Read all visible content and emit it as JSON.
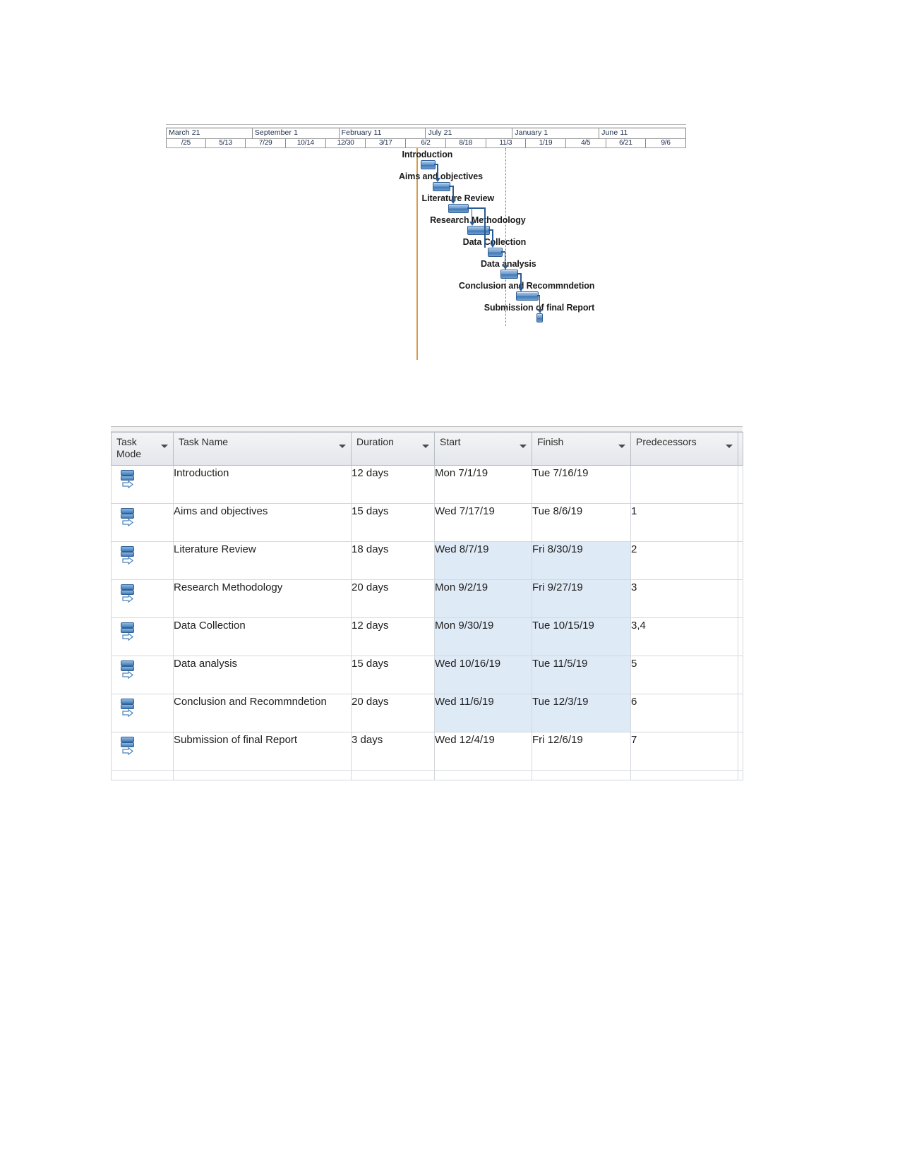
{
  "chart_data": {
    "type": "bar",
    "subtype": "gantt",
    "title": "",
    "xlabel": "",
    "ylabel": "",
    "grid": false,
    "legend": "none",
    "timeline": {
      "major_ticks": [
        "March 21",
        "September 1",
        "February 11",
        "July 21",
        "January 1",
        "June 11"
      ],
      "minor_ticks": [
        "/25",
        "5/13",
        "7/29",
        "10/14",
        "12/30",
        "3/17",
        "6/2",
        "8/18",
        "11/3",
        "1/19",
        "4/5",
        "6/21",
        "9/6"
      ]
    },
    "markers": [
      {
        "name": "progress-line",
        "color": "#d79b45",
        "style": "solid",
        "near_tick": "6/2"
      },
      {
        "name": "status-line",
        "color": "#6b6b6b",
        "style": "dotted",
        "near_tick": "11/3"
      }
    ],
    "categories": [
      "Introduction",
      "Aims and objectives",
      "Literature Review",
      "Research Methodology",
      "Data Collection",
      "Data analysis",
      "Conclusion and Recommndetion",
      "Submission of final Report"
    ],
    "values": [
      12,
      15,
      18,
      20,
      12,
      15,
      20,
      3
    ],
    "value_unit": "days",
    "bars": [
      {
        "label": "Introduction",
        "start": "Mon 7/1/19",
        "finish": "Tue 7/16/19",
        "days": 12,
        "left_pct": 49.0,
        "width_pct": 2.5
      },
      {
        "label": "Aims and objectives",
        "start": "Wed 7/17/19",
        "finish": "Tue 8/6/19",
        "days": 15,
        "left_pct": 51.3,
        "width_pct": 3.1
      },
      {
        "label": "Literature Review",
        "start": "Wed 8/7/19",
        "finish": "Fri 8/30/19",
        "days": 18,
        "left_pct": 54.3,
        "width_pct": 3.7
      },
      {
        "label": "Research Methodology",
        "start": "Mon 9/2/19",
        "finish": "Fri 9/27/19",
        "days": 20,
        "left_pct": 57.9,
        "width_pct": 4.1
      },
      {
        "label": "Data Collection",
        "start": "Mon 9/30/19",
        "finish": "Tue 10/15/19",
        "days": 12,
        "left_pct": 61.9,
        "width_pct": 2.5
      },
      {
        "label": "Data analysis",
        "start": "Wed 10/16/19",
        "finish": "Tue 11/5/19",
        "days": 15,
        "left_pct": 64.3,
        "width_pct": 3.1
      },
      {
        "label": "Conclusion and Recommndetion",
        "start": "Wed 11/6/19",
        "finish": "Tue 12/3/19",
        "days": 20,
        "left_pct": 67.3,
        "width_pct": 4.1
      },
      {
        "label": "Submission of final Report",
        "start": "Wed 12/4/19",
        "finish": "Fri 12/6/19",
        "days": 3,
        "left_pct": 71.3,
        "width_pct": 0.9
      }
    ]
  },
  "table": {
    "columns": [
      {
        "key": "mode",
        "label": "Task Mode",
        "sortable": true,
        "highlighted": false
      },
      {
        "key": "name",
        "label": "Task Name",
        "sortable": true,
        "highlighted": false
      },
      {
        "key": "duration",
        "label": "Duration",
        "sortable": true,
        "highlighted": false
      },
      {
        "key": "start",
        "label": "Start",
        "sortable": true,
        "highlighted": true
      },
      {
        "key": "finish",
        "label": "Finish",
        "sortable": true,
        "highlighted": false
      },
      {
        "key": "pred",
        "label": "Predecessors",
        "sortable": true,
        "highlighted": false
      }
    ],
    "rows": [
      {
        "name": "Introduction",
        "duration": "12 days",
        "start": "Mon 7/1/19",
        "finish": "Tue 7/16/19",
        "pred": "",
        "highlight": false
      },
      {
        "name": "Aims and objectives",
        "duration": "15 days",
        "start": "Wed 7/17/19",
        "finish": "Tue 8/6/19",
        "pred": "1",
        "highlight": false
      },
      {
        "name": "Literature Review",
        "duration": "18 days",
        "start": "Wed 8/7/19",
        "finish": "Fri 8/30/19",
        "pred": "2",
        "highlight": true
      },
      {
        "name": "Research Methodology",
        "duration": "20 days",
        "start": "Mon 9/2/19",
        "finish": "Fri 9/27/19",
        "pred": "3",
        "highlight": true
      },
      {
        "name": "Data Collection",
        "duration": "12 days",
        "start": "Mon 9/30/19",
        "finish": "Tue 10/15/19",
        "pred": "3,4",
        "highlight": true
      },
      {
        "name": "Data analysis",
        "duration": "15 days",
        "start": "Wed 10/16/19",
        "finish": "Tue 11/5/19",
        "pred": "5",
        "highlight": true
      },
      {
        "name": "Conclusion and Recommndetion",
        "duration": "20 days",
        "start": "Wed 11/6/19",
        "finish": "Tue 12/3/19",
        "pred": "6",
        "highlight": true
      },
      {
        "name": "Submission of final Report",
        "duration": "3 days",
        "start": "Wed 12/4/19",
        "finish": "Fri 12/6/19",
        "pred": "7",
        "highlight": false
      }
    ]
  },
  "colors": {
    "bar_fill": "#3f78b4",
    "bar_border": "#2f5f94",
    "link_line": "#2a5a93",
    "progress_line": "#d79b45",
    "start_header": "#ffcf56",
    "row_highlight": "#dfeaf7"
  }
}
